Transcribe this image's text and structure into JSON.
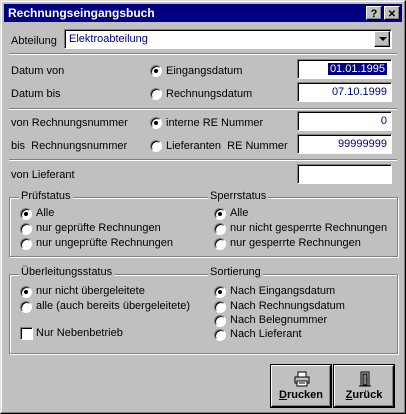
{
  "window": {
    "title": "Rechnungseingangsbuch",
    "help_btn": "?",
    "close_btn": "✕"
  },
  "abteilung": {
    "label": "Abteilung",
    "value": "Elektroabteilung"
  },
  "datum": {
    "von_label": "Datum von",
    "bis_label": "Datum bis",
    "opt_eingang": "Eingangsdatum",
    "opt_rechnung": "Rechnungsdatum",
    "von_value": "01.01.1995",
    "bis_value": "07.10.1999"
  },
  "nummer": {
    "von_label": "von Rechnungsnummer",
    "bis_label": "bis  Rechnungsnummer",
    "opt_intern": "interne RE Nummer",
    "opt_lieferant": "Lieferanten  RE Nummer",
    "von_value": "0",
    "bis_value": "99999999"
  },
  "lieferant": {
    "label": "von Lieferant",
    "value": ""
  },
  "pruefstatus": {
    "title": "Prüfstatus",
    "items": [
      "Alle",
      "nur geprüfte Rechnungen",
      "nur ungeprüfte Rechnungen"
    ]
  },
  "sperrstatus": {
    "title": "Sperrstatus",
    "items": [
      "Alle",
      "nur nicht gesperrte Rechnungen",
      "nur gesperrte Rechnungen"
    ]
  },
  "ueberleitung": {
    "title": "Überleitungsstatus",
    "items": [
      "nur nicht übergeleitete",
      "alle (auch bereits übergeleitete)"
    ],
    "nebenbetrieb": "Nur Nebenbetrieb"
  },
  "sortierung": {
    "title": "Sortierung",
    "items": [
      "Nach Eingangsdatum",
      "Nach Rechnungsdatum",
      "Nach Belegnummer",
      "Nach Lieferant"
    ]
  },
  "buttons": {
    "drucken_u": "D",
    "drucken_rest": "rucken",
    "zurueck_u": "Z",
    "zurueck_rest": "urück"
  },
  "icons": {
    "printer": "printer-icon",
    "door": "door-icon",
    "combo": "chevron-down-icon"
  }
}
